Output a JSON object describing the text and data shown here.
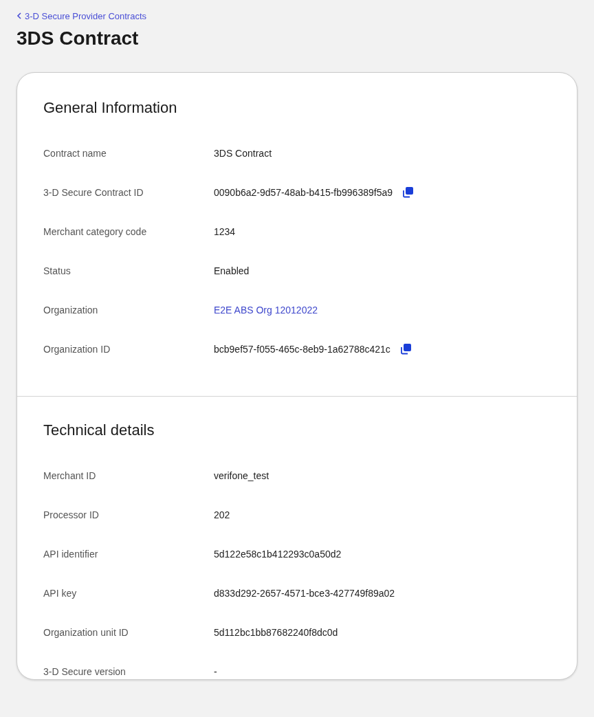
{
  "breadcrumb": {
    "label": "3-D Secure Provider Contracts"
  },
  "title": "3DS Contract",
  "sections": [
    {
      "heading": "General Information",
      "rows": [
        {
          "label": "Contract name",
          "value": "3DS Contract",
          "kind": "text"
        },
        {
          "label": "3-D Secure Contract ID",
          "value": "0090b6a2-9d57-48ab-b415-fb996389f5a9",
          "kind": "copy"
        },
        {
          "label": "Merchant category code",
          "value": "1234",
          "kind": "text"
        },
        {
          "label": "Status",
          "value": "Enabled",
          "kind": "text"
        },
        {
          "label": "Organization",
          "value": "E2E ABS Org 12012022",
          "kind": "link"
        },
        {
          "label": "Organization ID",
          "value": "bcb9ef57-f055-465c-8eb9-1a62788c421c",
          "kind": "copy"
        }
      ]
    },
    {
      "heading": "Technical details",
      "rows": [
        {
          "label": "Merchant ID",
          "value": "verifone_test",
          "kind": "text"
        },
        {
          "label": "Processor ID",
          "value": "202",
          "kind": "text"
        },
        {
          "label": "API identifier",
          "value": "5d122e58c1b412293c0a50d2",
          "kind": "text"
        },
        {
          "label": "API key",
          "value": "d833d292-2657-4571-bce3-427749f89a02",
          "kind": "text"
        },
        {
          "label": "Organization unit ID",
          "value": "5d112bc1bb87682240f8dc0d",
          "kind": "text"
        },
        {
          "label": "3-D Secure version",
          "value": "-",
          "kind": "text"
        }
      ]
    }
  ]
}
